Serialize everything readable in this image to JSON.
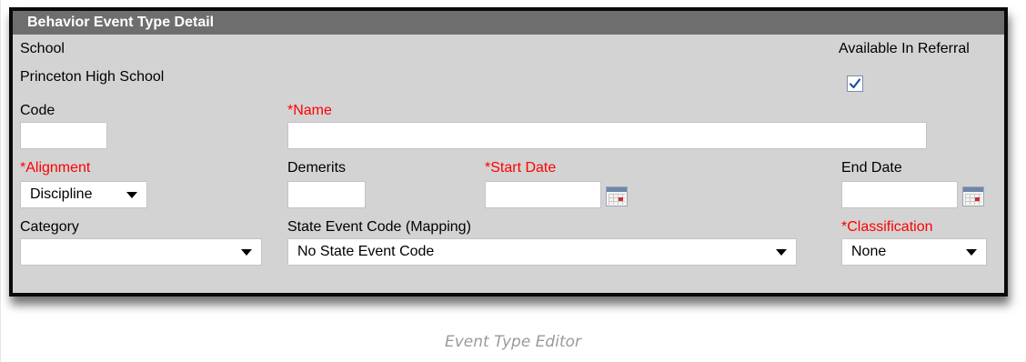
{
  "panel": {
    "title": "Behavior Event Type Detail",
    "school_label": "School",
    "school_value": "Princeton High School",
    "available_in_referral_label": "Available In Referral",
    "available_in_referral_checked": true,
    "code_label": "Code",
    "code_value": "",
    "name_label": "*Name",
    "name_value": "",
    "alignment_label": "*Alignment",
    "alignment_value": "Discipline",
    "demerits_label": "Demerits",
    "demerits_value": "",
    "start_date_label": "*Start Date",
    "start_date_value": "",
    "end_date_label": "End Date",
    "end_date_value": "",
    "category_label": "Category",
    "category_value": "",
    "state_event_code_label": "State Event Code (Mapping)",
    "state_event_code_value": "No State Event Code",
    "classification_label": "*Classification",
    "classification_value": "None"
  },
  "icons": {
    "calendar": "calendar-icon",
    "dropdown": "chevron-down-icon",
    "check": "checkmark-icon"
  },
  "colors": {
    "header_bg": "#6e6e6e",
    "panel_bg": "#d3d3d3",
    "required_label": "#ff0000",
    "caption_text": "#9a9a9a"
  },
  "caption": "Event Type Editor"
}
